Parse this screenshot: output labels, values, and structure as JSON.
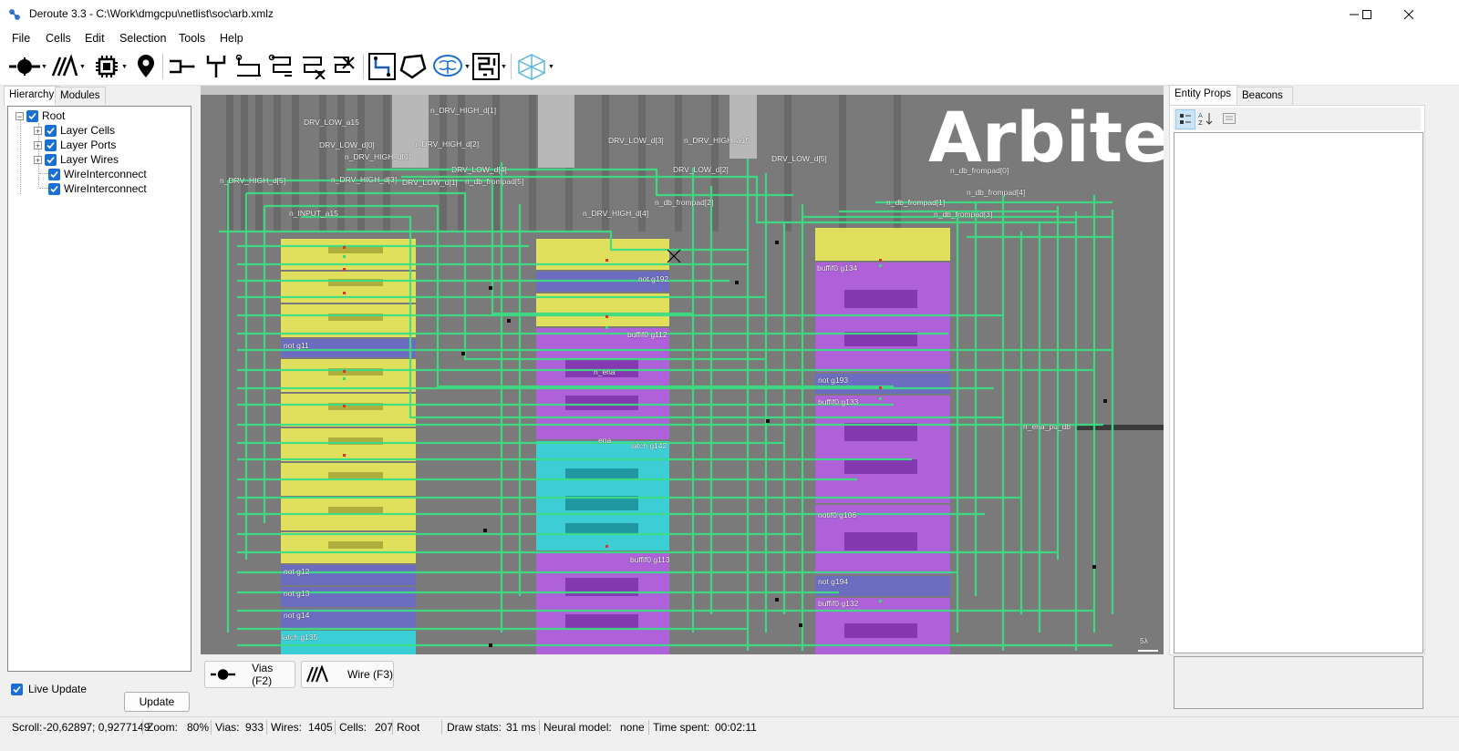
{
  "window": {
    "title": "Deroute 3.3 - C:\\Work\\dmgcpu\\netlist\\soc\\arb.xmlz",
    "minimize_icon": "minimize-icon",
    "maximize_icon": "maximize-icon",
    "close_icon": "close-icon"
  },
  "menu": [
    "File",
    "Cells",
    "Edit",
    "Selection",
    "Tools",
    "Help"
  ],
  "left_panel": {
    "tabs": [
      "Hierarchy",
      "Modules"
    ],
    "tree": {
      "root": "Root",
      "children": [
        "Layer Cells",
        "Layer Ports",
        "Layer Wires",
        "WireInterconnect",
        "WireInterconnect"
      ]
    },
    "live_update_label": "Live Update",
    "update_button": "Update"
  },
  "canvas": {
    "title": "Arbiter",
    "scale_label": "5λ",
    "labels": {
      "l01": "DRV_LOW_a15",
      "l02": "n_DRV_HIGH_d[1]",
      "l03": "DRV_LOW_d[0]",
      "l04": "n_DRV_HIGH_d[2]",
      "l05": "n_DRV_HIGH_d[0]",
      "l06": "DRV_LOW_d[3]",
      "l07": "n_DRV_HIGH_a15",
      "l08": "DRV_LOW_d[4]",
      "l09": "DRV_LOW_d[2]",
      "l10": "DRV_LOW_d[5]",
      "l11": "n_db_frompad[0]",
      "l12": "n_DRV_HIGH_d[5]",
      "l13": "n_DRV_HIGH_d[3]",
      "l14": "DRV_LOW_d[1]",
      "l15": "n_db_frompad[5]",
      "l16": "n_db_frompad[4]",
      "l17": "n_db_frompad[2]",
      "l18": "n_db_frompad[1]",
      "l19": "n_db_frompad[3]",
      "l20": "n_INPUT_a15",
      "l21": "n_DRV_HIGH_d[4]",
      "l22": "not g192",
      "l23": "buffif0 g134",
      "l24": "not g11",
      "l25": "buffif0 g112",
      "l26": "n_ena",
      "l27": "not g193",
      "l28": "buffif0 g133",
      "l29": "n_ena_pu_db",
      "l30": "latch g142",
      "l31": "notif0 g106",
      "l32": "not g12",
      "l33": "buffif0 g113",
      "l34": "not g13",
      "l35": "not g194",
      "l36": "buffif0 g132",
      "l37": "not g14",
      "l38": "latch g135",
      "l39": "ena"
    }
  },
  "mode_buttons": [
    {
      "label": "Vias (F2)",
      "icon": "via-tool-icon"
    },
    {
      "label": "Wire (F3)",
      "icon": "wire-tool-icon"
    }
  ],
  "right_panel": {
    "tabs": [
      "Entity Props",
      "Beacons"
    ]
  },
  "status": {
    "scroll_label": "Scroll:",
    "scroll_value": "-20,62897; 0,9277149",
    "zoom_label": "Zoom:",
    "zoom_value": "80%",
    "vias_label": "Vias:",
    "vias_value": "933",
    "wires_label": "Wires:",
    "wires_value": "1405",
    "cells_label": "Cells:",
    "cells_value": "207",
    "module": "Root",
    "draw_label": "Draw stats:",
    "draw_value": "31 ms",
    "neural_label": "Neural model:",
    "neural_value": "none",
    "time_label": "Time spent:",
    "time_value": "00:02:11"
  },
  "colors": {
    "wire": "#3ddc84",
    "cell_not": "#e8e85a",
    "cell_buf": "#b25ee0",
    "cell_latch": "#37d4dc",
    "cell_inv": "#6c6cc4",
    "checkbox": "#1a6ed8"
  }
}
